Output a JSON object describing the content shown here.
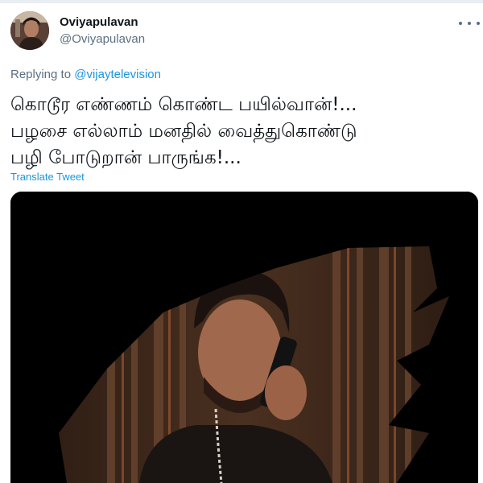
{
  "tweet": {
    "author": {
      "display_name": "Oviyapulavan",
      "handle": "@Oviyapulavan"
    },
    "more_icon": "more-horizontal-icon",
    "replying_to": {
      "prefix": "Replying to",
      "mention": "@vijaytelevision"
    },
    "text_lines": [
      "கொடூர எண்ணம் கொண்ட பயில்வான்!...",
      "பழசை எல்லாம் மனதில் வைத்துகொண்டு",
      "பழி போடுறான் பாருங்க!..."
    ],
    "translate_label": "Translate Tweet",
    "media": {
      "description_icon": "video-still-image"
    }
  },
  "colors": {
    "link": "#1b95e0",
    "secondary_text": "#5b7083",
    "primary_text": "#0f1419"
  }
}
